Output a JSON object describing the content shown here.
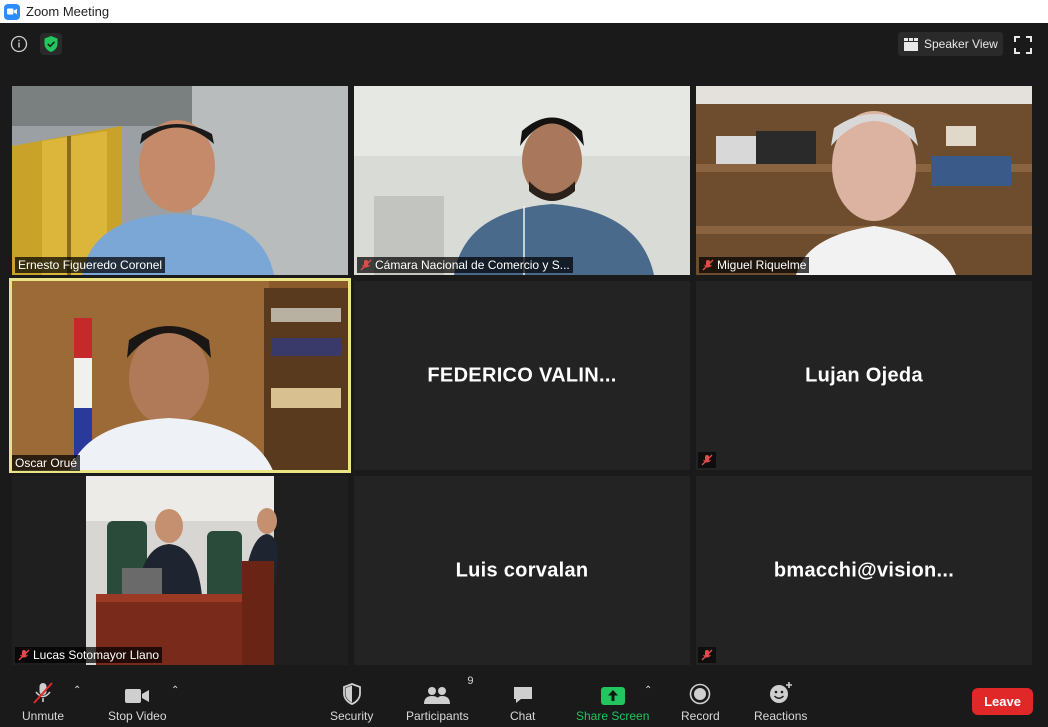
{
  "window": {
    "title": "Zoom Meeting"
  },
  "header": {
    "speaker_view_label": "Speaker View"
  },
  "participants": [
    {
      "name": "Ernesto Figueredo Coronel",
      "muted": false,
      "video": true
    },
    {
      "name": "Cámara Nacional de Comercio y S...",
      "muted": true,
      "video": true
    },
    {
      "name": "Miguel Riquelme",
      "muted": true,
      "video": true
    },
    {
      "name": "Oscar Orué",
      "muted": false,
      "video": true,
      "active_speaker": true
    },
    {
      "name": "FEDERICO  VALIN...",
      "muted": false,
      "video": false
    },
    {
      "name": "Lujan Ojeda",
      "muted": true,
      "video": false
    },
    {
      "name": "Lucas Sotomayor Llano",
      "muted": true,
      "video": true
    },
    {
      "name": "Luis corvalan",
      "muted": false,
      "video": false
    },
    {
      "name": "bmacchi@vision...",
      "muted": true,
      "video": false
    }
  ],
  "toolbar": {
    "unmute": "Unmute",
    "stop_video": "Stop Video",
    "security": "Security",
    "participants": "Participants",
    "participants_count": "9",
    "chat": "Chat",
    "share_screen": "Share Screen",
    "record": "Record",
    "reactions": "Reactions",
    "leave": "Leave"
  },
  "colors": {
    "accent_green": "#22c55e",
    "leave_red": "#e02828",
    "active_border": "#e9e585"
  }
}
